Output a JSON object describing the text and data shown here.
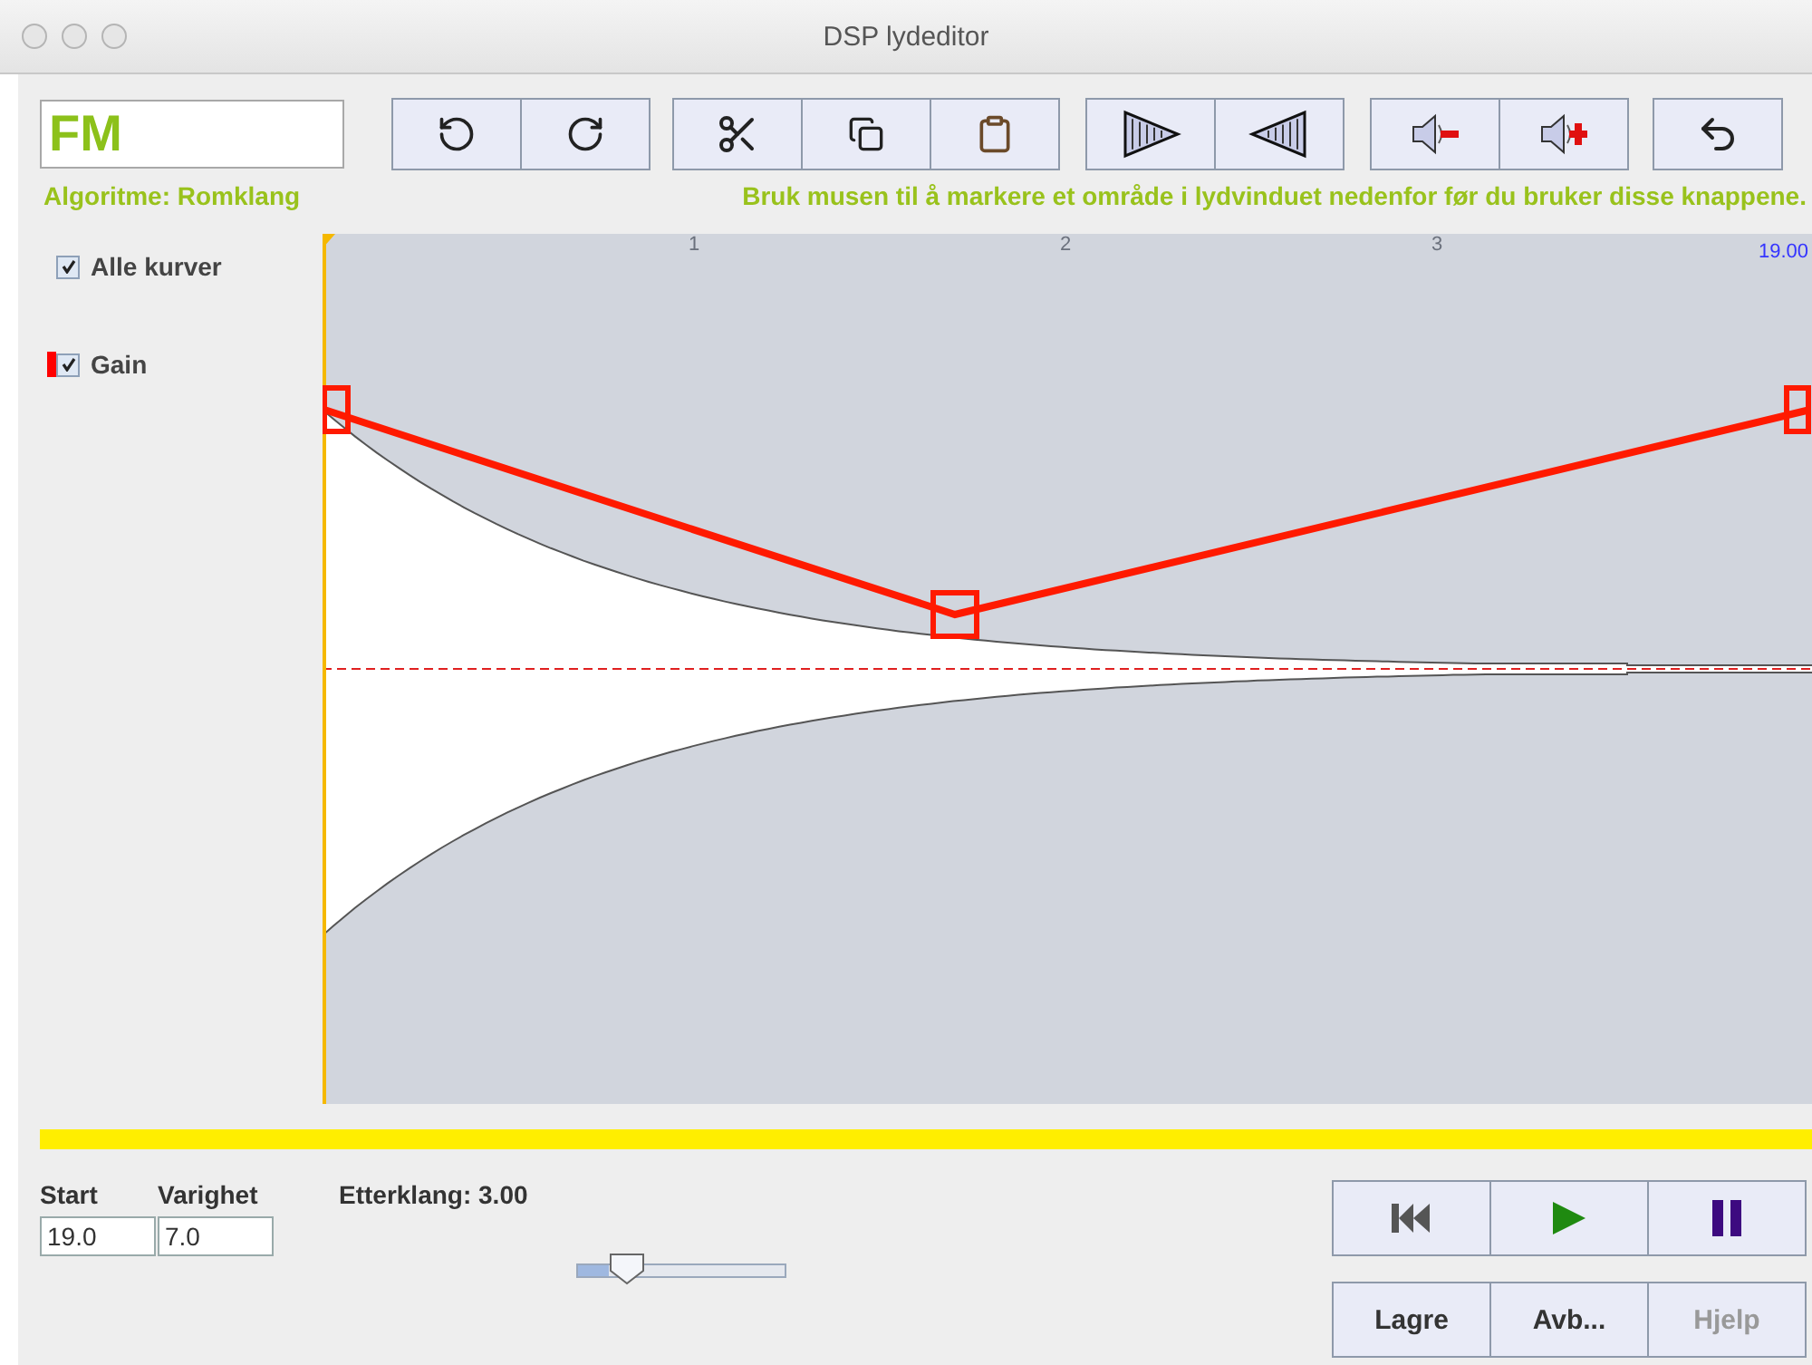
{
  "window": {
    "title": "DSP lydeditor"
  },
  "name_field": {
    "value": "FM"
  },
  "algorithm": "Algoritme: Romklang",
  "hint": "Bruk musen til å markere et område i lydvinduet nedenfor før du bruker disse knappene.",
  "curves": [
    {
      "label": "Alle kurver",
      "checked": true
    },
    {
      "label": "Gain",
      "checked": true,
      "color": "#ff0000"
    }
  ],
  "ruler": {
    "ticks": [
      "1",
      "2",
      "3"
    ],
    "end_time": "19.00"
  },
  "position": {
    "start_label": "Start",
    "start_value": "19.0",
    "duration_label": "Varighet",
    "duration_value": "7.0"
  },
  "reverb": {
    "label": "Etterklang: 3.00",
    "level": 0.15
  },
  "buttons": [
    {
      "label": "Lagre",
      "disabled": false
    },
    {
      "label": "Avb...",
      "disabled": false
    },
    {
      "label": "Hjelp",
      "disabled": true
    }
  ]
}
